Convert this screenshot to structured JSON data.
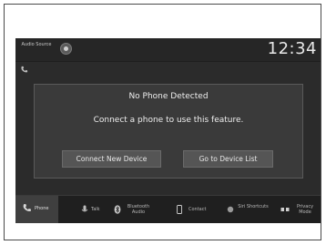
{
  "topbar": {
    "audio_source_label": "Audio Source",
    "clock": "12:34"
  },
  "dialog": {
    "title": "No Phone Detected",
    "message": "Connect a phone to use this feature.",
    "connect_button": "Connect New Device",
    "device_list_button": "Go to Device List"
  },
  "bottom_tabs": [
    {
      "label": "Phone",
      "icon": "phone-icon",
      "selected": true
    },
    {
      "label": "Talk",
      "icon": "microphone-icon"
    },
    {
      "label": "Bluetooth Audio",
      "icon": "bluetooth-icon"
    },
    {
      "label": "Contact",
      "icon": "device-icon"
    },
    {
      "label": "Siri Shortcuts",
      "icon": "shortcut-icon"
    },
    {
      "label": "Privacy Mode",
      "icon": "privacy-icon"
    }
  ],
  "colors": {
    "screen_bg": "#2b2b2b",
    "dialog_bg": "#3a3a3a",
    "button_bg": "#555555",
    "text": "#ededed"
  }
}
